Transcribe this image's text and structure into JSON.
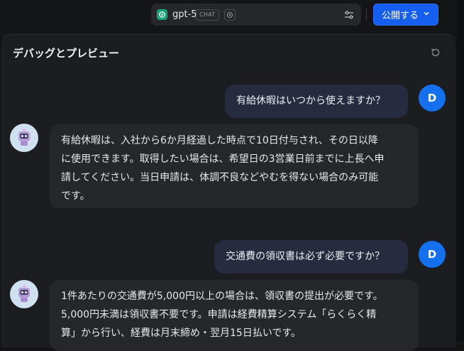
{
  "header": {
    "model_name": "gpt-5",
    "model_badge": "CHAT",
    "publish_label": "公開する"
  },
  "panel": {
    "title": "デバッグとプレビュー"
  },
  "messages": [
    {
      "role": "user",
      "avatar": "D",
      "text": "有給休暇はいつから使えますか？"
    },
    {
      "role": "bot",
      "lines": [
        "有給休暇は、入社から6か月経過した時点で10日付与され、その日以降",
        "に使用できます。取得したい場合は、希望日の3営業日前までに上長へ申",
        "請してください。当日申請は、体調不良などやむを得ない場合のみ可能",
        "です。"
      ]
    },
    {
      "role": "user",
      "avatar": "D",
      "text": "交通費の領収書は必ず必要ですか？"
    },
    {
      "role": "bot",
      "lines": [
        "1件あたりの交通費が5,000円以上の場合は、領収書の提出が必要です。",
        "5,000円未満は領収書不要です。申請は経費精算システム「らくらく精",
        "算」から行い、経費は月末締め・翌月15日払いです。"
      ]
    }
  ],
  "colors": {
    "accent": "#155eef",
    "user_avatar": "#1570ef",
    "user_bubble": "#262b3f",
    "bot_bubble": "#26272b",
    "background": "#141517"
  }
}
